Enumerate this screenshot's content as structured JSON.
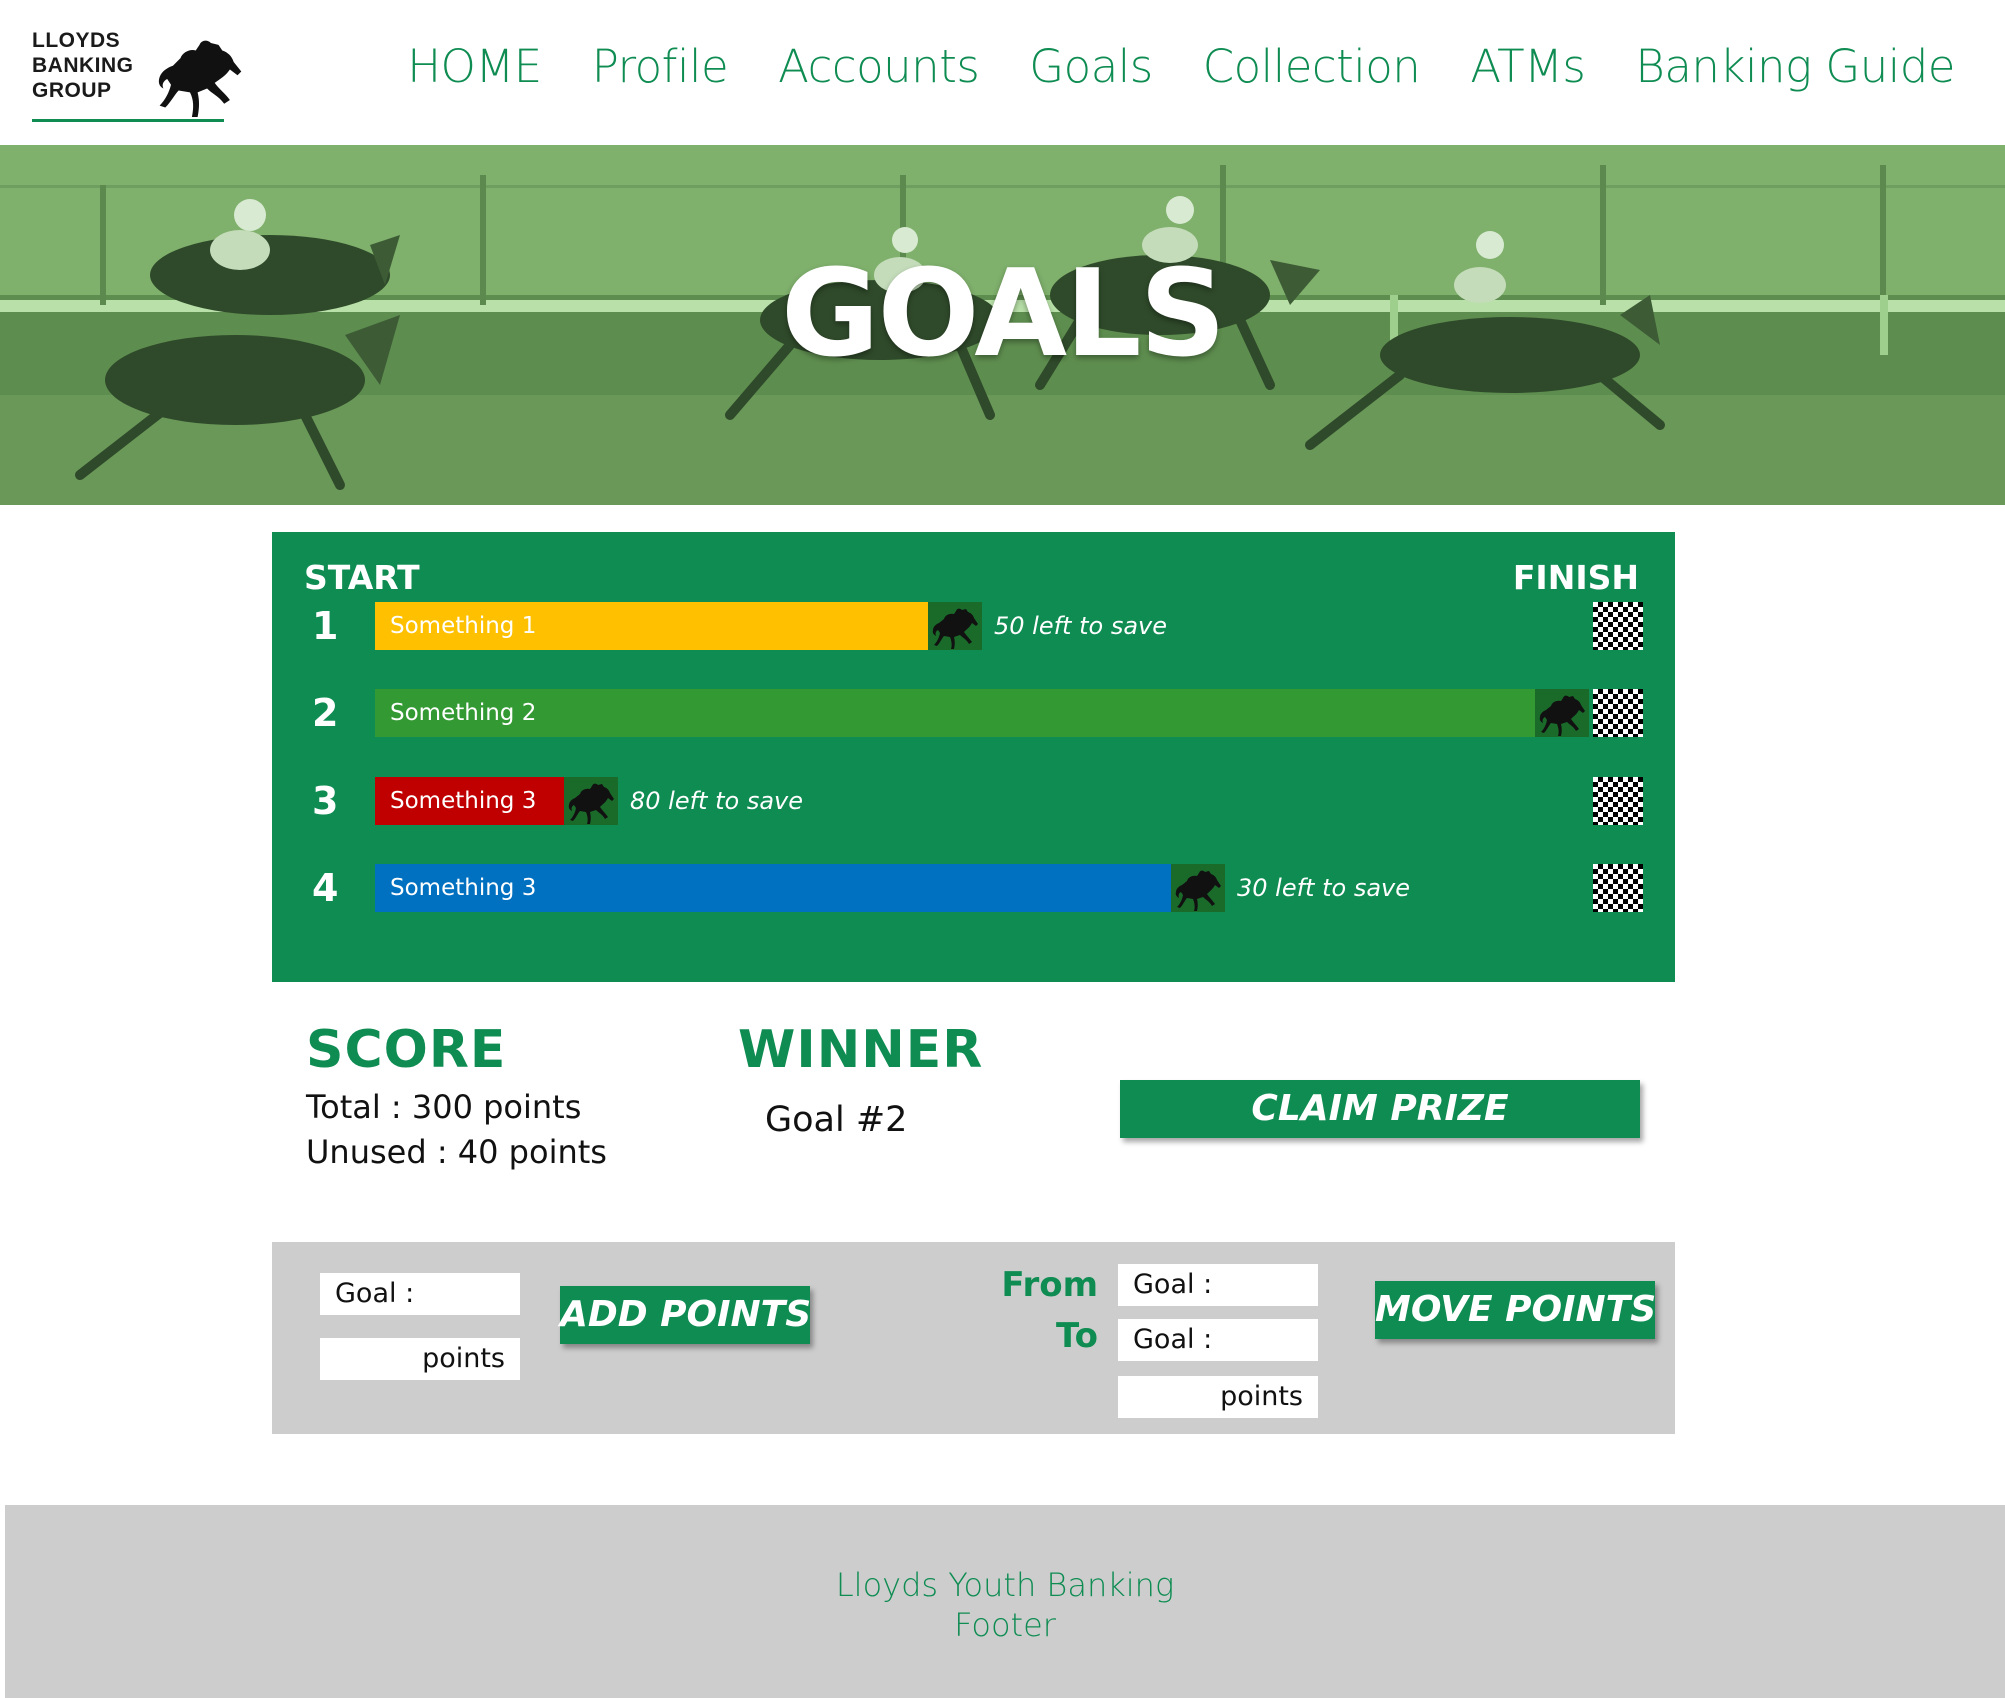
{
  "brand": {
    "line1": "LLOYDS",
    "line2": "BANKING",
    "line3": "GROUP",
    "icon": "horse-logo-icon"
  },
  "nav": {
    "items": [
      {
        "label": "HOME"
      },
      {
        "label": "Profile"
      },
      {
        "label": "Accounts"
      },
      {
        "label": "Goals"
      },
      {
        "label": "Collection"
      },
      {
        "label": "ATMs"
      },
      {
        "label": "Banking Guide"
      }
    ]
  },
  "banner": {
    "title": "GOALS"
  },
  "race": {
    "start_label": "START",
    "finish_label": "FINISH",
    "lanes": [
      {
        "number": "1",
        "label": "Something  1",
        "progress": 0.5,
        "color": "#ffc000",
        "left_text": "50 left to save"
      },
      {
        "number": "2",
        "label": "Something 2",
        "progress": 1.0,
        "color": "#339933",
        "left_text": ""
      },
      {
        "number": "3",
        "label": "Something 3",
        "progress": 0.2,
        "color": "#c00000",
        "left_text": "80 left to save"
      },
      {
        "number": "4",
        "label": "Something  3",
        "progress": 0.7,
        "color": "#0070c0",
        "left_text": "30 left to save"
      }
    ]
  },
  "score": {
    "heading": "SCORE",
    "total": "Total : 300 points",
    "unused": "Unused : 40 points"
  },
  "winner": {
    "heading": "WINNER",
    "value": "Goal #2"
  },
  "claim_button": "CLAIM PRIZE",
  "add_points": {
    "goal_field": "Goal :",
    "points_field": "points",
    "button": "ADD POINTS"
  },
  "move_points": {
    "from_label": "From",
    "to_label": "To",
    "from_field": "Goal :",
    "to_field": "Goal :",
    "points_field": "points",
    "button": "MOVE POINTS"
  },
  "footer": {
    "line1": "Lloyds Youth Banking",
    "line2": "Footer"
  },
  "colors": {
    "brand_green": "#0e8c52",
    "panel_gray": "#cdcdcd"
  }
}
